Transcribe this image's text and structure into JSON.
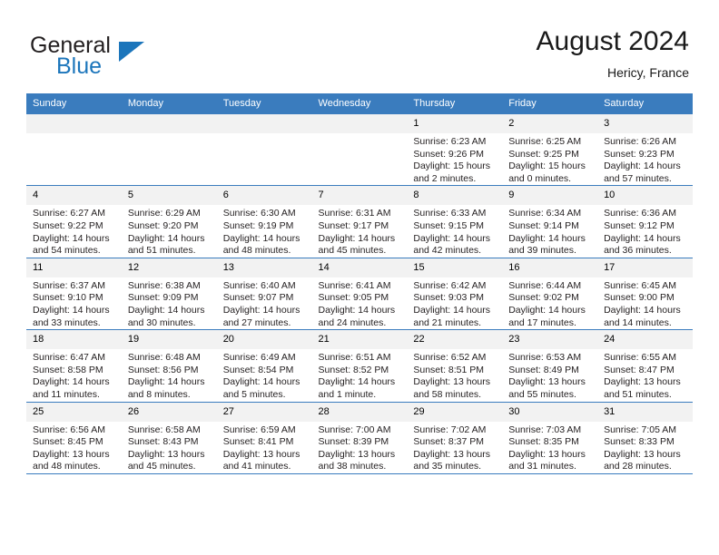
{
  "logo": {
    "word1": "General",
    "word2": "Blue",
    "mark": "triangle-mark",
    "brand_color": "#1b75bb"
  },
  "header": {
    "title": "August 2024",
    "location": "Hericy, France"
  },
  "theme": {
    "header_blue": "#3a7cbe",
    "daynum_band": "#f2f2f2",
    "text": "#231f20"
  },
  "weekday_headers": [
    "Sunday",
    "Monday",
    "Tuesday",
    "Wednesday",
    "Thursday",
    "Friday",
    "Saturday"
  ],
  "weeks": [
    [
      {
        "day": "",
        "empty": true,
        "sunrise": "",
        "sunset": "",
        "daylight1": "",
        "daylight2": ""
      },
      {
        "day": "",
        "empty": true,
        "sunrise": "",
        "sunset": "",
        "daylight1": "",
        "daylight2": ""
      },
      {
        "day": "",
        "empty": true,
        "sunrise": "",
        "sunset": "",
        "daylight1": "",
        "daylight2": ""
      },
      {
        "day": "",
        "empty": true,
        "sunrise": "",
        "sunset": "",
        "daylight1": "",
        "daylight2": ""
      },
      {
        "day": "1",
        "sunrise": "Sunrise: 6:23 AM",
        "sunset": "Sunset: 9:26 PM",
        "daylight1": "Daylight: 15 hours",
        "daylight2": "and 2 minutes."
      },
      {
        "day": "2",
        "sunrise": "Sunrise: 6:25 AM",
        "sunset": "Sunset: 9:25 PM",
        "daylight1": "Daylight: 15 hours",
        "daylight2": "and 0 minutes."
      },
      {
        "day": "3",
        "sunrise": "Sunrise: 6:26 AM",
        "sunset": "Sunset: 9:23 PM",
        "daylight1": "Daylight: 14 hours",
        "daylight2": "and 57 minutes."
      }
    ],
    [
      {
        "day": "4",
        "sunrise": "Sunrise: 6:27 AM",
        "sunset": "Sunset: 9:22 PM",
        "daylight1": "Daylight: 14 hours",
        "daylight2": "and 54 minutes."
      },
      {
        "day": "5",
        "sunrise": "Sunrise: 6:29 AM",
        "sunset": "Sunset: 9:20 PM",
        "daylight1": "Daylight: 14 hours",
        "daylight2": "and 51 minutes."
      },
      {
        "day": "6",
        "sunrise": "Sunrise: 6:30 AM",
        "sunset": "Sunset: 9:19 PM",
        "daylight1": "Daylight: 14 hours",
        "daylight2": "and 48 minutes."
      },
      {
        "day": "7",
        "sunrise": "Sunrise: 6:31 AM",
        "sunset": "Sunset: 9:17 PM",
        "daylight1": "Daylight: 14 hours",
        "daylight2": "and 45 minutes."
      },
      {
        "day": "8",
        "sunrise": "Sunrise: 6:33 AM",
        "sunset": "Sunset: 9:15 PM",
        "daylight1": "Daylight: 14 hours",
        "daylight2": "and 42 minutes."
      },
      {
        "day": "9",
        "sunrise": "Sunrise: 6:34 AM",
        "sunset": "Sunset: 9:14 PM",
        "daylight1": "Daylight: 14 hours",
        "daylight2": "and 39 minutes."
      },
      {
        "day": "10",
        "sunrise": "Sunrise: 6:36 AM",
        "sunset": "Sunset: 9:12 PM",
        "daylight1": "Daylight: 14 hours",
        "daylight2": "and 36 minutes."
      }
    ],
    [
      {
        "day": "11",
        "sunrise": "Sunrise: 6:37 AM",
        "sunset": "Sunset: 9:10 PM",
        "daylight1": "Daylight: 14 hours",
        "daylight2": "and 33 minutes."
      },
      {
        "day": "12",
        "sunrise": "Sunrise: 6:38 AM",
        "sunset": "Sunset: 9:09 PM",
        "daylight1": "Daylight: 14 hours",
        "daylight2": "and 30 minutes."
      },
      {
        "day": "13",
        "sunrise": "Sunrise: 6:40 AM",
        "sunset": "Sunset: 9:07 PM",
        "daylight1": "Daylight: 14 hours",
        "daylight2": "and 27 minutes."
      },
      {
        "day": "14",
        "sunrise": "Sunrise: 6:41 AM",
        "sunset": "Sunset: 9:05 PM",
        "daylight1": "Daylight: 14 hours",
        "daylight2": "and 24 minutes."
      },
      {
        "day": "15",
        "sunrise": "Sunrise: 6:42 AM",
        "sunset": "Sunset: 9:03 PM",
        "daylight1": "Daylight: 14 hours",
        "daylight2": "and 21 minutes."
      },
      {
        "day": "16",
        "sunrise": "Sunrise: 6:44 AM",
        "sunset": "Sunset: 9:02 PM",
        "daylight1": "Daylight: 14 hours",
        "daylight2": "and 17 minutes."
      },
      {
        "day": "17",
        "sunrise": "Sunrise: 6:45 AM",
        "sunset": "Sunset: 9:00 PM",
        "daylight1": "Daylight: 14 hours",
        "daylight2": "and 14 minutes."
      }
    ],
    [
      {
        "day": "18",
        "sunrise": "Sunrise: 6:47 AM",
        "sunset": "Sunset: 8:58 PM",
        "daylight1": "Daylight: 14 hours",
        "daylight2": "and 11 minutes."
      },
      {
        "day": "19",
        "sunrise": "Sunrise: 6:48 AM",
        "sunset": "Sunset: 8:56 PM",
        "daylight1": "Daylight: 14 hours",
        "daylight2": "and 8 minutes."
      },
      {
        "day": "20",
        "sunrise": "Sunrise: 6:49 AM",
        "sunset": "Sunset: 8:54 PM",
        "daylight1": "Daylight: 14 hours",
        "daylight2": "and 5 minutes."
      },
      {
        "day": "21",
        "sunrise": "Sunrise: 6:51 AM",
        "sunset": "Sunset: 8:52 PM",
        "daylight1": "Daylight: 14 hours",
        "daylight2": "and 1 minute."
      },
      {
        "day": "22",
        "sunrise": "Sunrise: 6:52 AM",
        "sunset": "Sunset: 8:51 PM",
        "daylight1": "Daylight: 13 hours",
        "daylight2": "and 58 minutes."
      },
      {
        "day": "23",
        "sunrise": "Sunrise: 6:53 AM",
        "sunset": "Sunset: 8:49 PM",
        "daylight1": "Daylight: 13 hours",
        "daylight2": "and 55 minutes."
      },
      {
        "day": "24",
        "sunrise": "Sunrise: 6:55 AM",
        "sunset": "Sunset: 8:47 PM",
        "daylight1": "Daylight: 13 hours",
        "daylight2": "and 51 minutes."
      }
    ],
    [
      {
        "day": "25",
        "sunrise": "Sunrise: 6:56 AM",
        "sunset": "Sunset: 8:45 PM",
        "daylight1": "Daylight: 13 hours",
        "daylight2": "and 48 minutes."
      },
      {
        "day": "26",
        "sunrise": "Sunrise: 6:58 AM",
        "sunset": "Sunset: 8:43 PM",
        "daylight1": "Daylight: 13 hours",
        "daylight2": "and 45 minutes."
      },
      {
        "day": "27",
        "sunrise": "Sunrise: 6:59 AM",
        "sunset": "Sunset: 8:41 PM",
        "daylight1": "Daylight: 13 hours",
        "daylight2": "and 41 minutes."
      },
      {
        "day": "28",
        "sunrise": "Sunrise: 7:00 AM",
        "sunset": "Sunset: 8:39 PM",
        "daylight1": "Daylight: 13 hours",
        "daylight2": "and 38 minutes."
      },
      {
        "day": "29",
        "sunrise": "Sunrise: 7:02 AM",
        "sunset": "Sunset: 8:37 PM",
        "daylight1": "Daylight: 13 hours",
        "daylight2": "and 35 minutes."
      },
      {
        "day": "30",
        "sunrise": "Sunrise: 7:03 AM",
        "sunset": "Sunset: 8:35 PM",
        "daylight1": "Daylight: 13 hours",
        "daylight2": "and 31 minutes."
      },
      {
        "day": "31",
        "sunrise": "Sunrise: 7:05 AM",
        "sunset": "Sunset: 8:33 PM",
        "daylight1": "Daylight: 13 hours",
        "daylight2": "and 28 minutes."
      }
    ]
  ]
}
